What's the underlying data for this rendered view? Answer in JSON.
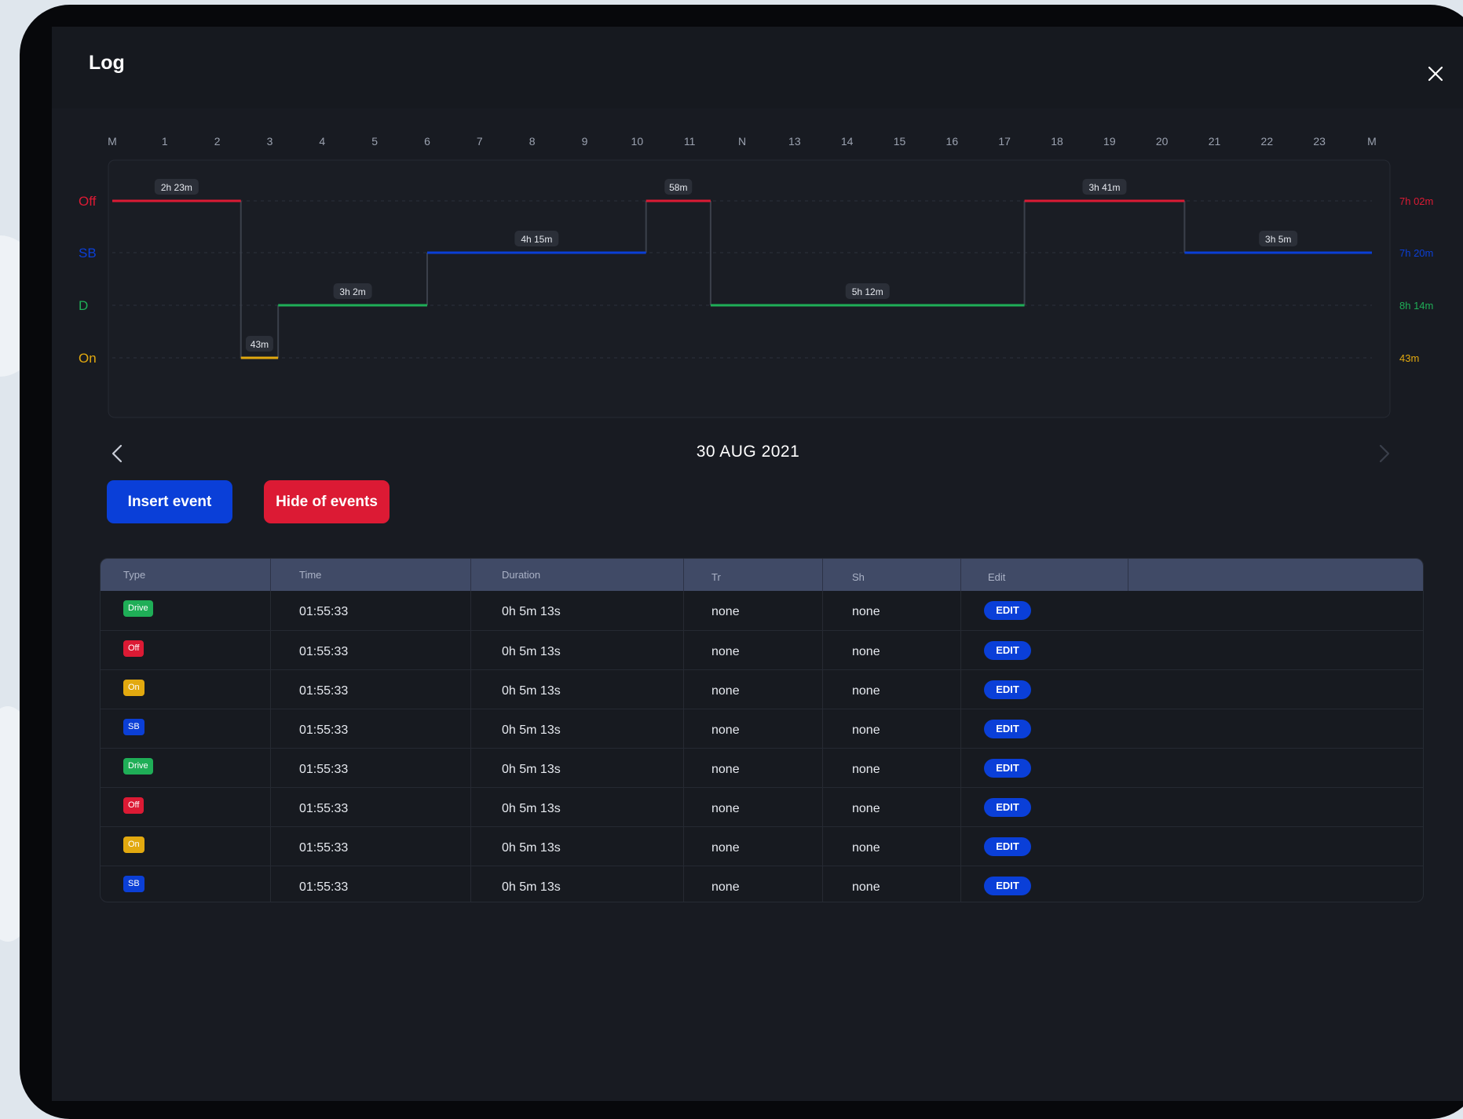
{
  "window": {
    "title": "Log"
  },
  "chart": {
    "hour_labels": [
      "M",
      "1",
      "2",
      "3",
      "4",
      "5",
      "6",
      "7",
      "8",
      "9",
      "10",
      "11",
      "N",
      "13",
      "14",
      "15",
      "16",
      "17",
      "18",
      "19",
      "20",
      "21",
      "22",
      "23",
      "M"
    ],
    "status_rows": [
      {
        "key": "off",
        "label": "Off",
        "total": "7h 02m",
        "color": "#dc1a34"
      },
      {
        "key": "sb",
        "label": "SB",
        "total": "7h 20m",
        "color": "#0b3fd6"
      },
      {
        "key": "d",
        "label": "D",
        "total": "8h 14m",
        "color": "#1fae57"
      },
      {
        "key": "on",
        "label": "On",
        "total": "43m",
        "color": "#e2a90f"
      }
    ],
    "segments": [
      {
        "status": "off",
        "start": 0,
        "end": 2.45,
        "label": "2h 23m"
      },
      {
        "status": "on",
        "start": 2.45,
        "end": 3.16,
        "label": "43m"
      },
      {
        "status": "d",
        "start": 3.16,
        "end": 6.0,
        "label": "3h 2m"
      },
      {
        "status": "sb",
        "start": 6.0,
        "end": 10.17,
        "label": "4h 15m"
      },
      {
        "status": "off",
        "start": 10.17,
        "end": 11.4,
        "label": "58m"
      },
      {
        "status": "d",
        "start": 11.4,
        "end": 17.38,
        "label": "5h 12m"
      },
      {
        "status": "off",
        "start": 17.38,
        "end": 20.43,
        "label": "3h 41m"
      },
      {
        "status": "sb",
        "start": 20.43,
        "end": 24.0,
        "label": "3h 5m"
      }
    ]
  },
  "date": "30 AUG 2021",
  "buttons": {
    "insert_label": "Insert event",
    "hide_label": "Hide of events"
  },
  "table": {
    "headers": [
      "Type",
      "Time",
      "Duration",
      "Tr",
      "Sh",
      "Edit"
    ],
    "status_colors": {
      "Drive": "#1fae57",
      "Off": "#dc1a34",
      "On": "#e2a90f",
      "SB": "#0b3fd6"
    },
    "rows": [
      {
        "type": "Drive",
        "time": "01:55:33",
        "duration": "0h 5m 13s",
        "tr": "none",
        "sh": "none",
        "edit": "EDIT"
      },
      {
        "type": "Off",
        "time": "01:55:33",
        "duration": "0h 5m 13s",
        "tr": "none",
        "sh": "none",
        "edit": "EDIT"
      },
      {
        "type": "On",
        "time": "01:55:33",
        "duration": "0h 5m 13s",
        "tr": "none",
        "sh": "none",
        "edit": "EDIT"
      },
      {
        "type": "SB",
        "time": "01:55:33",
        "duration": "0h 5m 13s",
        "tr": "none",
        "sh": "none",
        "edit": "EDIT"
      },
      {
        "type": "Drive",
        "time": "01:55:33",
        "duration": "0h 5m 13s",
        "tr": "none",
        "sh": "none",
        "edit": "EDIT"
      },
      {
        "type": "Off",
        "time": "01:55:33",
        "duration": "0h 5m 13s",
        "tr": "none",
        "sh": "none",
        "edit": "EDIT"
      },
      {
        "type": "On",
        "time": "01:55:33",
        "duration": "0h 5m 13s",
        "tr": "none",
        "sh": "none",
        "edit": "EDIT"
      },
      {
        "type": "SB",
        "time": "01:55:33",
        "duration": "0h 5m 13s",
        "tr": "none",
        "sh": "none",
        "edit": "EDIT"
      }
    ]
  }
}
